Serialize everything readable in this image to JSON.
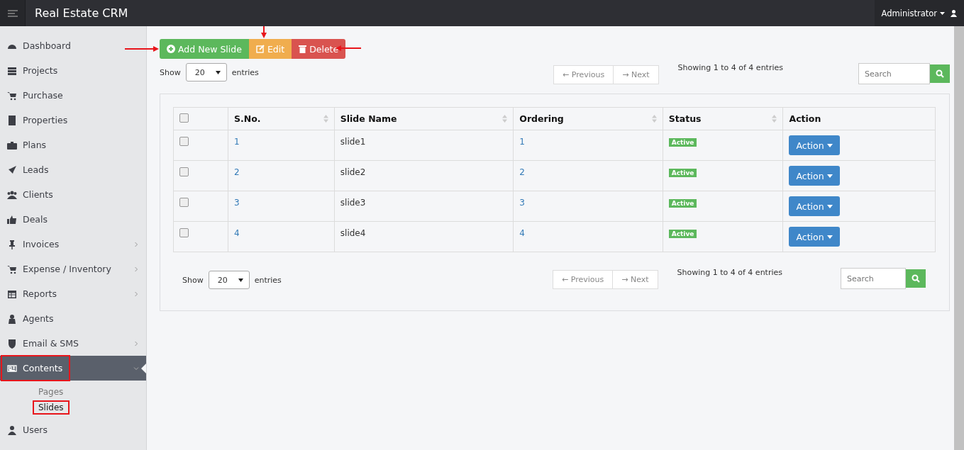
{
  "header": {
    "title": "Real Estate CRM",
    "user": "Administrator"
  },
  "sidebar": {
    "items": [
      {
        "label": "Dashboard",
        "has_submenu": false,
        "expanded": false,
        "highlighted": false
      },
      {
        "label": "Projects",
        "has_submenu": false,
        "expanded": false,
        "highlighted": false
      },
      {
        "label": "Purchase",
        "has_submenu": false,
        "expanded": false,
        "highlighted": false
      },
      {
        "label": "Properties",
        "has_submenu": false,
        "expanded": false,
        "highlighted": false
      },
      {
        "label": "Plans",
        "has_submenu": false,
        "expanded": false,
        "highlighted": false
      },
      {
        "label": "Leads",
        "has_submenu": false,
        "expanded": false,
        "highlighted": false
      },
      {
        "label": "Clients",
        "has_submenu": false,
        "expanded": false,
        "highlighted": false
      },
      {
        "label": "Deals",
        "has_submenu": false,
        "expanded": false,
        "highlighted": false
      },
      {
        "label": "Invoices",
        "has_submenu": true,
        "expanded": false,
        "highlighted": false
      },
      {
        "label": "Expense / Inventory",
        "has_submenu": true,
        "expanded": false,
        "highlighted": false
      },
      {
        "label": "Reports",
        "has_submenu": true,
        "expanded": false,
        "highlighted": false
      },
      {
        "label": "Agents",
        "has_submenu": false,
        "expanded": false,
        "highlighted": false
      },
      {
        "label": "Email & SMS",
        "has_submenu": true,
        "expanded": false,
        "highlighted": false
      },
      {
        "label": "Contents",
        "has_submenu": true,
        "expanded": true,
        "highlighted": true,
        "children": [
          {
            "label": "Pages",
            "selected": false,
            "highlighted": false
          },
          {
            "label": "Slides",
            "selected": true,
            "highlighted": true
          }
        ]
      },
      {
        "label": "Users",
        "has_submenu": false,
        "expanded": false,
        "highlighted": false
      }
    ]
  },
  "toolbar": {
    "buttons": [
      {
        "label": "Add New Slide",
        "kind": "add"
      },
      {
        "label": "Edit",
        "kind": "edit"
      },
      {
        "label": "Delete",
        "kind": "delete"
      }
    ]
  },
  "top_controls": {
    "show_label": "Show",
    "page_size": "20",
    "entries_label": "entries",
    "previous": "← Previous",
    "next": "→ Next",
    "info": "Showing 1 to 4 of 4 entries",
    "search_placeholder": "Search"
  },
  "table": {
    "select_all_checked": false,
    "columns": [
      {
        "kind": "check"
      },
      {
        "label": "S.No.",
        "sortable": true
      },
      {
        "label": "Slide Name",
        "sortable": true
      },
      {
        "label": "Ordering",
        "sortable": true
      },
      {
        "label": "Status",
        "sortable": true
      },
      {
        "label": "Action",
        "sortable": false
      }
    ],
    "rows": [
      {
        "checked": false,
        "sno": "1",
        "name": "slide1",
        "ordering": "1",
        "status": "Active",
        "action": "Action"
      },
      {
        "checked": false,
        "sno": "2",
        "name": "slide2",
        "ordering": "2",
        "status": "Active",
        "action": "Action"
      },
      {
        "checked": false,
        "sno": "3",
        "name": "slide3",
        "ordering": "3",
        "status": "Active",
        "action": "Action"
      },
      {
        "checked": false,
        "sno": "4",
        "name": "slide4",
        "ordering": "4",
        "status": "Active",
        "action": "Action"
      }
    ]
  },
  "bottom_controls": {
    "show_label": "Show",
    "page_size": "20",
    "entries_label": "entries",
    "previous": "← Previous",
    "next": "→ Next",
    "info": "Showing 1 to 4 of 4 entries",
    "search_placeholder": "Search"
  }
}
